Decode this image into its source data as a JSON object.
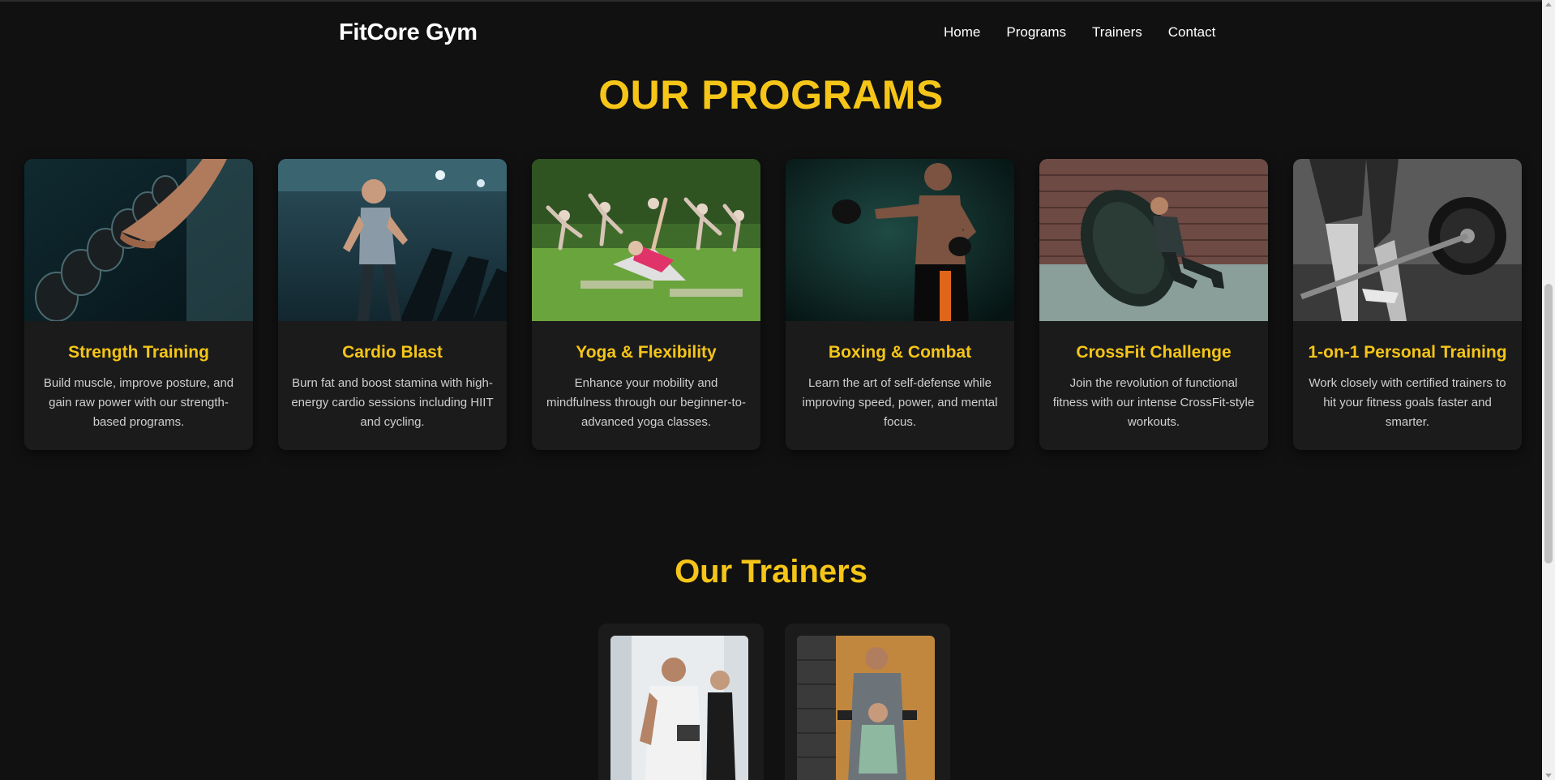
{
  "nav": {
    "brand": "FitCore Gym",
    "links": [
      "Home",
      "Programs",
      "Trainers",
      "Contact"
    ]
  },
  "programs": {
    "title": "OUR PROGRAMS",
    "cards": [
      {
        "title": "Strength Training",
        "description": "Build muscle, improve posture, and gain raw power with our strength-based programs.",
        "image": "dumbbell-rack-photo"
      },
      {
        "title": "Cardio Blast",
        "description": "Burn fat and boost stamina with high-energy cardio sessions including HIIT and cycling.",
        "image": "treadmill-runner-photo"
      },
      {
        "title": "Yoga & Flexibility",
        "description": "Enhance your mobility and mindfulness through our beginner-to-advanced yoga classes.",
        "image": "outdoor-yoga-class-photo"
      },
      {
        "title": "Boxing & Combat",
        "description": "Learn the art of self-defense while improving speed, power, and mental focus.",
        "image": "boxer-punching-photo"
      },
      {
        "title": "CrossFit Challenge",
        "description": "Join the revolution of functional fitness with our intense CrossFit-style workouts.",
        "image": "tire-flip-photo"
      },
      {
        "title": "1-on-1 Personal Training",
        "description": "Work closely with certified trainers to hit your fitness goals faster and smarter.",
        "image": "barbell-deadlift-photo"
      }
    ]
  },
  "trainers": {
    "title": "Our Trainers",
    "cards": [
      {
        "image": "trainer-with-client-tablet-photo"
      },
      {
        "image": "trainer-assisting-dumbbell-photo"
      }
    ]
  },
  "colors": {
    "background": "#111111",
    "card": "#1b1b1b",
    "accent": "#f5c518",
    "text": "#cfcfcf"
  }
}
